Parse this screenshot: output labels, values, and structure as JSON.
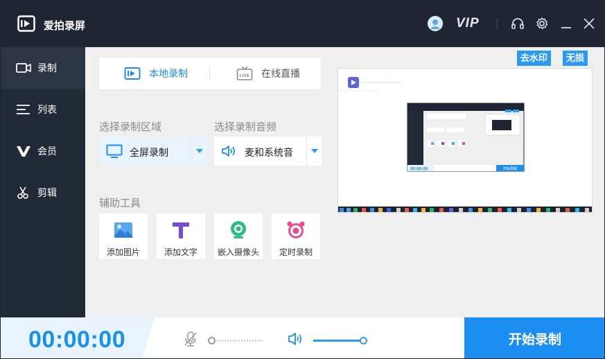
{
  "app": {
    "title": "爱拍录屏",
    "vip_label": "VIP"
  },
  "sidebar": {
    "items": [
      {
        "label": "录制",
        "icon": "record-icon",
        "active": true
      },
      {
        "label": "列表",
        "icon": "list-icon",
        "active": false
      },
      {
        "label": "会员",
        "icon": "vip-icon",
        "active": false
      },
      {
        "label": "剪辑",
        "icon": "scissors-icon",
        "active": false
      }
    ]
  },
  "modes": {
    "local": "本地录制",
    "live": "在线直播",
    "live_icon_text": "LIVE"
  },
  "region": {
    "label": "选择录制区域",
    "value": "全屏录制"
  },
  "audio": {
    "label": "选择录制音频",
    "value": "麦和系统音"
  },
  "tools": {
    "label": "辅助工具",
    "items": [
      {
        "label": "添加图片",
        "icon": "image-icon"
      },
      {
        "label": "添加文字",
        "icon": "text-icon"
      },
      {
        "label": "嵌入摄像头",
        "icon": "camera-icon"
      },
      {
        "label": "定时录制",
        "icon": "alarm-clock-icon"
      }
    ]
  },
  "preview": {
    "remove_watermark": "去水印",
    "lossless": "无损",
    "inner_timer": "00.00.00",
    "inner_start": "开始录制"
  },
  "bottom": {
    "timer": "00:00:00",
    "mic_level": 0.0,
    "volume_level": 1.0,
    "start_label": "开始录制"
  },
  "colors": {
    "accent": "#1c8ef1",
    "titlebar": "#1f2533",
    "sidebar": "#222937"
  }
}
